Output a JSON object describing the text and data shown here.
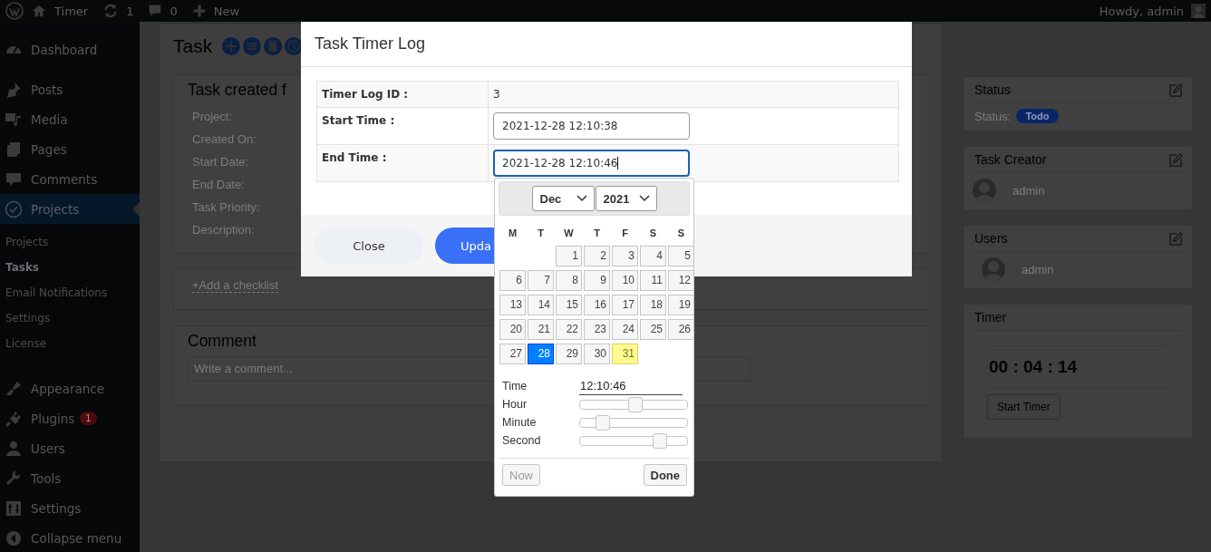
{
  "admin_bar": {
    "site": "Timer",
    "updates": "1",
    "comments": "0",
    "new": "New",
    "greeting": "Howdy, admin"
  },
  "sidebar": {
    "items": [
      {
        "label": "Dashboard",
        "selected": false
      },
      {
        "label": "Posts",
        "selected": false
      },
      {
        "label": "Media",
        "selected": false
      },
      {
        "label": "Pages",
        "selected": false
      },
      {
        "label": "Comments",
        "selected": false
      },
      {
        "label": "Projects",
        "selected": true,
        "children": [
          {
            "label": "Projects",
            "selected": false
          },
          {
            "label": "Tasks",
            "selected": true
          },
          {
            "label": "Email Notifications",
            "selected": false
          },
          {
            "label": "Settings",
            "selected": false
          },
          {
            "label": "License",
            "selected": false
          }
        ]
      },
      {
        "label": "Appearance",
        "selected": false
      },
      {
        "label": "Plugins",
        "selected": false,
        "badge": "1"
      },
      {
        "label": "Users",
        "selected": false
      },
      {
        "label": "Tools",
        "selected": false
      },
      {
        "label": "Settings",
        "selected": false
      },
      {
        "label": "Collapse menu",
        "selected": false
      }
    ]
  },
  "page": {
    "title": "Task"
  },
  "task_card": {
    "title": "Task created f",
    "fields": [
      "Project:",
      "Created On:",
      "Start Date:",
      "End Date:",
      "Task Priority:",
      "Description:"
    ]
  },
  "checklist": {
    "link": "+Add a checklist"
  },
  "comment": {
    "title": "Comment",
    "placeholder": "Write a comment..."
  },
  "status_card": {
    "title": "Status",
    "label": "Status:",
    "badge": "Todo"
  },
  "creator_card": {
    "title": "Task Creator",
    "user": "admin"
  },
  "users_card": {
    "title": "Users",
    "users": [
      "admin"
    ]
  },
  "timer_card": {
    "title": "Timer",
    "display": "00 : 04 : 14",
    "button": "Start Timer"
  },
  "modal": {
    "title": "Task Timer Log",
    "rows": [
      {
        "label": "Timer Log ID :",
        "value": "3",
        "kind": "text"
      },
      {
        "label": "Start Time :",
        "value": "2021-12-28 12:10:38",
        "kind": "input",
        "focused": false
      },
      {
        "label": "End Time :",
        "value": "2021-12-28 12:10:46",
        "kind": "input",
        "focused": true
      }
    ],
    "buttons": [
      {
        "label": "Close",
        "kind": "secondary"
      },
      {
        "label": "Upda",
        "kind": "primary"
      }
    ]
  },
  "datepicker": {
    "month": "Dec",
    "year": "2021",
    "weekdays": [
      "M",
      "T",
      "W",
      "T",
      "F",
      "S",
      "S"
    ],
    "days": [
      {
        "label": "1",
        "selected": false,
        "today": false
      },
      {
        "label": "2",
        "selected": false,
        "today": false
      },
      {
        "label": "3",
        "selected": false,
        "today": false
      },
      {
        "label": "4",
        "selected": false,
        "today": false
      },
      {
        "label": "5",
        "selected": false,
        "today": false
      },
      {
        "label": "6",
        "selected": false,
        "today": false
      },
      {
        "label": "7",
        "selected": false,
        "today": false
      },
      {
        "label": "8",
        "selected": false,
        "today": false
      },
      {
        "label": "9",
        "selected": false,
        "today": false
      },
      {
        "label": "10",
        "selected": false,
        "today": false
      },
      {
        "label": "11",
        "selected": false,
        "today": false
      },
      {
        "label": "12",
        "selected": false,
        "today": false
      },
      {
        "label": "13",
        "selected": false,
        "today": false
      },
      {
        "label": "14",
        "selected": false,
        "today": false
      },
      {
        "label": "15",
        "selected": false,
        "today": false
      },
      {
        "label": "16",
        "selected": false,
        "today": false
      },
      {
        "label": "17",
        "selected": false,
        "today": false
      },
      {
        "label": "18",
        "selected": false,
        "today": false
      },
      {
        "label": "19",
        "selected": false,
        "today": false
      },
      {
        "label": "20",
        "selected": false,
        "today": false
      },
      {
        "label": "21",
        "selected": false,
        "today": false
      },
      {
        "label": "22",
        "selected": false,
        "today": false
      },
      {
        "label": "23",
        "selected": false,
        "today": false
      },
      {
        "label": "24",
        "selected": false,
        "today": false
      },
      {
        "label": "25",
        "selected": false,
        "today": false
      },
      {
        "label": "26",
        "selected": false,
        "today": false
      },
      {
        "label": "27",
        "selected": false,
        "today": false
      },
      {
        "label": "28",
        "selected": true,
        "today": false
      },
      {
        "label": "29",
        "selected": false,
        "today": false
      },
      {
        "label": "30",
        "selected": false,
        "today": false
      },
      {
        "label": "31",
        "selected": false,
        "today": true
      }
    ],
    "time_label": "Time",
    "time": "12:10:46",
    "sliders": [
      {
        "label": "Hour",
        "level": 0.52
      },
      {
        "label": "Minute",
        "level": 0.17
      },
      {
        "label": "Second",
        "level": 0.78
      }
    ],
    "buttons": [
      {
        "label": "Now",
        "disabled": true
      },
      {
        "label": "Done",
        "disabled": false
      }
    ]
  }
}
